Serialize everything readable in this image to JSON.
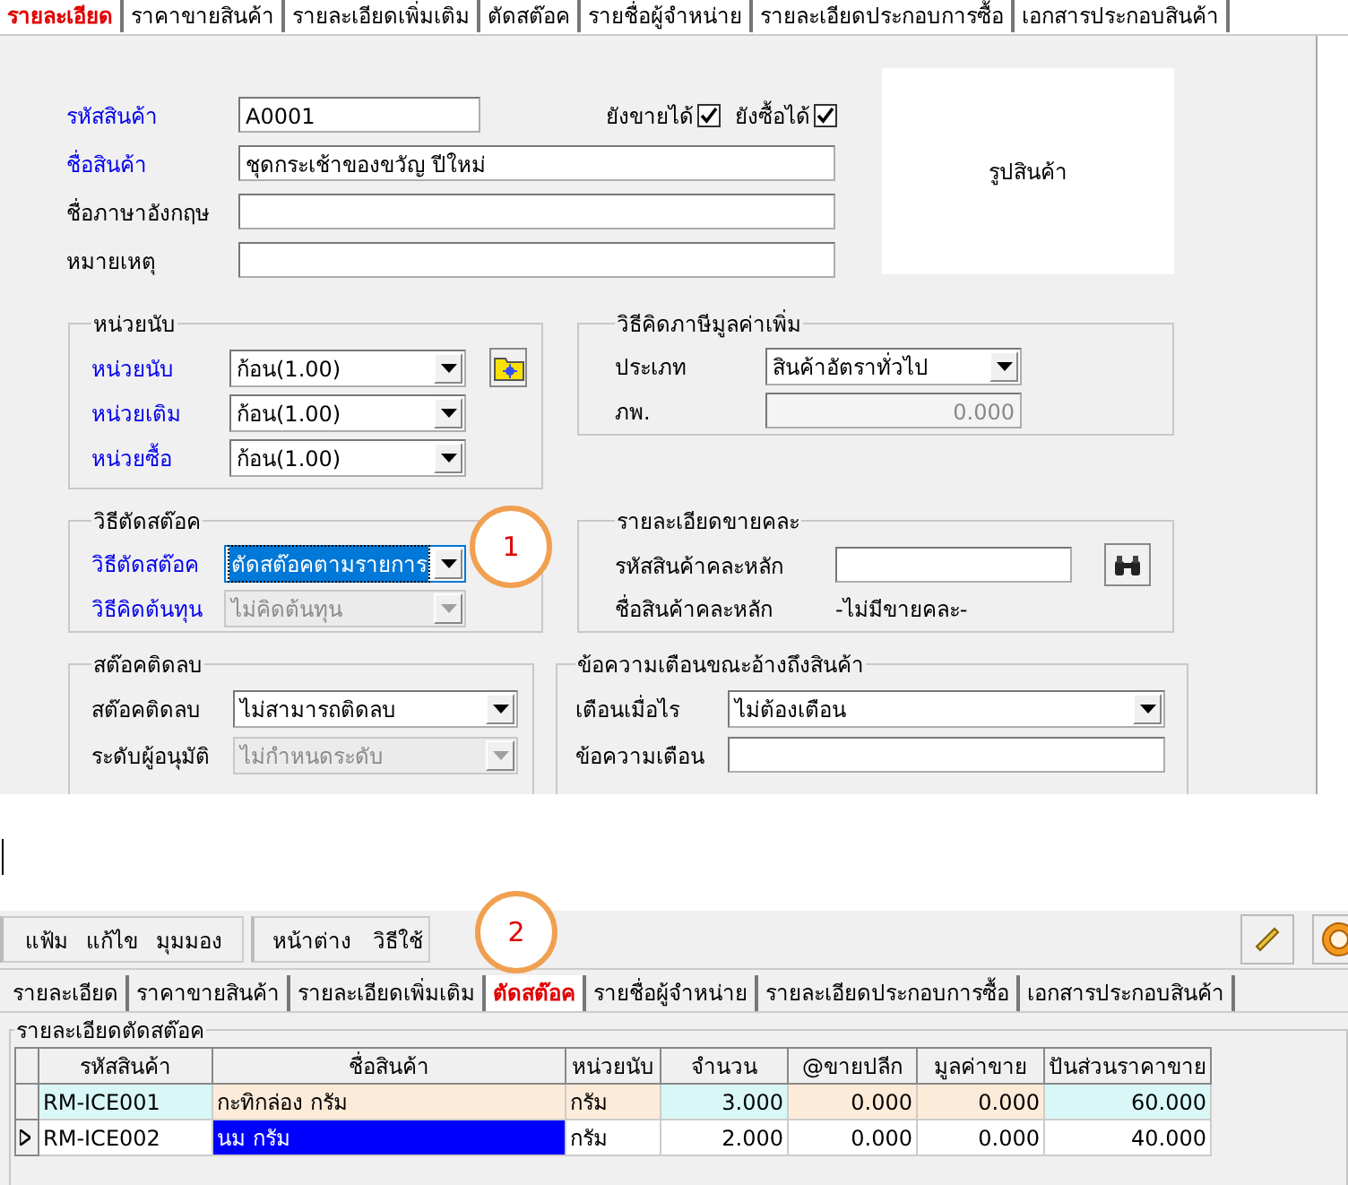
{
  "top_tabs": [
    {
      "label": "รายละเอียด",
      "selected": true
    },
    {
      "label": "ราคาขายสินค้า",
      "selected": false
    },
    {
      "label": "รายละเอียดเพิ่มเติม",
      "selected": false
    },
    {
      "label": "ตัดสต๊อค",
      "selected": false
    },
    {
      "label": "รายชื่อผู้จำหน่าย",
      "selected": false
    },
    {
      "label": "รายละเอียดประกอบการซื้อ",
      "selected": false
    },
    {
      "label": "เอกสารประกอบสินค้า",
      "selected": false
    }
  ],
  "general": {
    "fields": [
      {
        "label": "รหัสสินค้า",
        "value": "A0001",
        "required": true
      },
      {
        "label": "ชื่อสินค้า",
        "value": "ชุดกระเช้าของขวัญ ปีใหม่",
        "required": true
      },
      {
        "label": "ชื่อภาษาอังกฤษ",
        "required": false
      },
      {
        "label": "หมายเหตุ",
        "required": false
      }
    ],
    "flags": [
      {
        "label": "ยังขายได้",
        "checked": true
      },
      {
        "label": "ยังซื้อได้",
        "checked": true
      }
    ],
    "image_label": "รูปสินค้า"
  },
  "groups": [
    {
      "title": "หน่วยนับ",
      "fields": [
        {
          "kind": "combo",
          "label": "หน่วยนับ",
          "value": "ก้อน(1.00)",
          "required": true,
          "disabled": false,
          "focused": false
        },
        {
          "kind": "combo",
          "label": "หน่วยเติม",
          "value": "ก้อน(1.00)",
          "required": true,
          "disabled": false,
          "focused": false
        },
        {
          "kind": "combo",
          "label": "หน่วยซื้อ",
          "value": "ก้อน(1.00)",
          "required": true,
          "disabled": false,
          "focused": false
        }
      ]
    },
    {
      "title": "วิธีคิดภาษีมูลค่าเพิ่ม",
      "fields": [
        {
          "kind": "combo",
          "label": "ประเภท",
          "value": "สินค้าอัตราทั่วไป",
          "required": false,
          "disabled": false,
          "focused": false
        },
        {
          "kind": "readout",
          "label": "ภพ.",
          "value": "0.000",
          "required": false,
          "disabled": true
        }
      ]
    },
    {
      "title": "วิธีตัดสต๊อค",
      "fields": [
        {
          "kind": "combo",
          "label": "วิธีตัดสต๊อค",
          "value": "ตัดสต๊อคตามรายการ",
          "required": true,
          "disabled": false,
          "focused": true
        },
        {
          "kind": "combo",
          "label": "วิธีคิดต้นทุน",
          "value": "ไม่คิดต้นทุน",
          "required": true,
          "disabled": true,
          "focused": false
        }
      ]
    },
    {
      "title": "รายละเอียดขายคละ",
      "fields": [
        {
          "kind": "text",
          "label": "รหัสสินค้าคละหลัก",
          "required": false
        },
        {
          "kind": "label",
          "label": "ชื่อสินค้าคละหลัก",
          "value": "-ไม่มีขายคละ-",
          "required": false
        }
      ]
    },
    {
      "title": "สต๊อคติดลบ",
      "fields": [
        {
          "kind": "combo",
          "label": "สต๊อคติดลบ",
          "value": "ไม่สามารถติดลบ",
          "required": false,
          "disabled": false,
          "focused": false
        },
        {
          "kind": "combo",
          "label": "ระดับผู้อนุมัติ",
          "value": "ไม่กำหนดระดับ",
          "required": false,
          "disabled": true,
          "focused": false
        }
      ]
    },
    {
      "title": "ข้อความเตือนขณะอ้างถึงสินค้า",
      "fields": [
        {
          "kind": "combo",
          "label": "เตือนเมื่อไร",
          "value": "ไม่ต้องเตือน",
          "required": false,
          "disabled": false,
          "focused": false
        },
        {
          "kind": "text",
          "label": "ข้อความเตือน",
          "required": false
        }
      ]
    }
  ],
  "callouts": [
    "1",
    "2"
  ],
  "bottom": {
    "menu_groups": [
      {
        "items": [
          "แฟ้ม",
          "แก้ไข",
          "มุมมอง"
        ]
      },
      {
        "items": [
          "หน้าต่าง",
          "วิธีใช้"
        ]
      }
    ],
    "tabs": [
      {
        "label": "รายละเอียด",
        "selected": false
      },
      {
        "label": "ราคาขายสินค้า",
        "selected": false
      },
      {
        "label": "รายละเอียดเพิ่มเติม",
        "selected": false
      },
      {
        "label": "ตัดสต๊อค",
        "selected": true
      },
      {
        "label": "รายชื่อผู้จำหน่าย",
        "selected": false
      },
      {
        "label": "รายละเอียดประกอบการซื้อ",
        "selected": false
      },
      {
        "label": "เอกสารประกอบสินค้า",
        "selected": false
      }
    ],
    "grid": {
      "title": "รายละเอียดตัดสต๊อค",
      "columns": [
        {
          "label": "รหัสสินค้า",
          "kind": "text",
          "color": "#d9f7f7"
        },
        {
          "label": "ชื่อสินค้า",
          "kind": "text",
          "color": "#fdebd9"
        },
        {
          "label": "หน่วยนับ",
          "kind": "text",
          "color": "#fdebd9"
        },
        {
          "label": "จำนวน",
          "kind": "number",
          "color": "#d9f7f7"
        },
        {
          "label": "@ขายปลีก",
          "kind": "number",
          "color": "#fdebd9"
        },
        {
          "label": "มูลค่าขาย",
          "kind": "number",
          "color": "#fdebd9"
        },
        {
          "label": "ปันส่วนราคาขาย",
          "kind": "number",
          "color": "#d9f7f7"
        }
      ],
      "rows": [
        {
          "selected": false,
          "cells": [
            "RM-ICE001",
            "กะทิกล่อง กรัม",
            "กรัม",
            "3.000",
            "0.000",
            "0.000",
            "60.000"
          ]
        },
        {
          "selected": true,
          "cells": [
            "RM-ICE002",
            "นม กรัม",
            "กรัม",
            "2.000",
            "0.000",
            "0.000",
            "40.000"
          ]
        }
      ]
    }
  }
}
